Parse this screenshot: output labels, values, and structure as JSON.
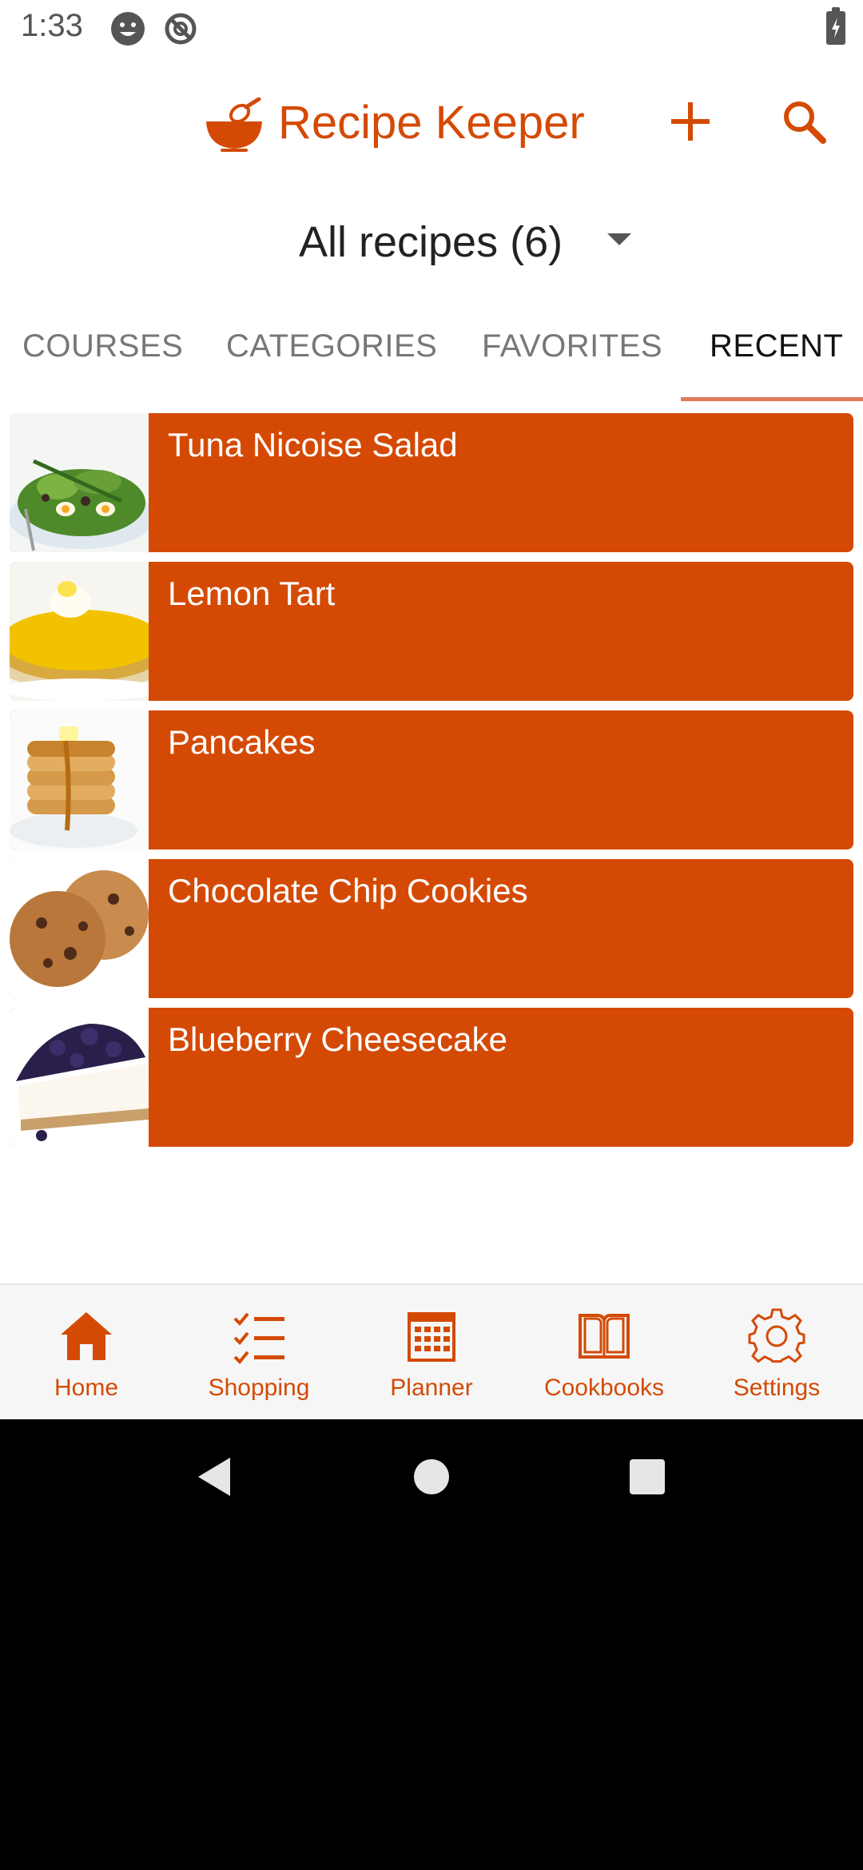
{
  "status_bar": {
    "time": "1:33"
  },
  "app_bar": {
    "title": "Recipe Keeper"
  },
  "filter": {
    "label": "All recipes (6)"
  },
  "tabs": [
    {
      "label": "COURSES",
      "active": false
    },
    {
      "label": "CATEGORIES",
      "active": false
    },
    {
      "label": "FAVORITES",
      "active": false
    },
    {
      "label": "RECENT",
      "active": true
    }
  ],
  "recipes": [
    {
      "name": "Tuna Nicoise Salad",
      "thumb": "salad-image"
    },
    {
      "name": "Lemon Tart",
      "thumb": "lemon-tart-image"
    },
    {
      "name": "Pancakes",
      "thumb": "pancakes-image"
    },
    {
      "name": "Chocolate Chip Cookies",
      "thumb": "cookies-image"
    },
    {
      "name": "Blueberry Cheesecake",
      "thumb": "cheesecake-image"
    }
  ],
  "bottom_nav": [
    {
      "label": "Home",
      "icon": "home-icon"
    },
    {
      "label": "Shopping",
      "icon": "checklist-icon"
    },
    {
      "label": "Planner",
      "icon": "calendar-icon"
    },
    {
      "label": "Cookbooks",
      "icon": "book-icon"
    },
    {
      "label": "Settings",
      "icon": "gear-icon"
    }
  ],
  "colors": {
    "accent": "#d44a05",
    "tab_indicator": "#e07a5a"
  }
}
